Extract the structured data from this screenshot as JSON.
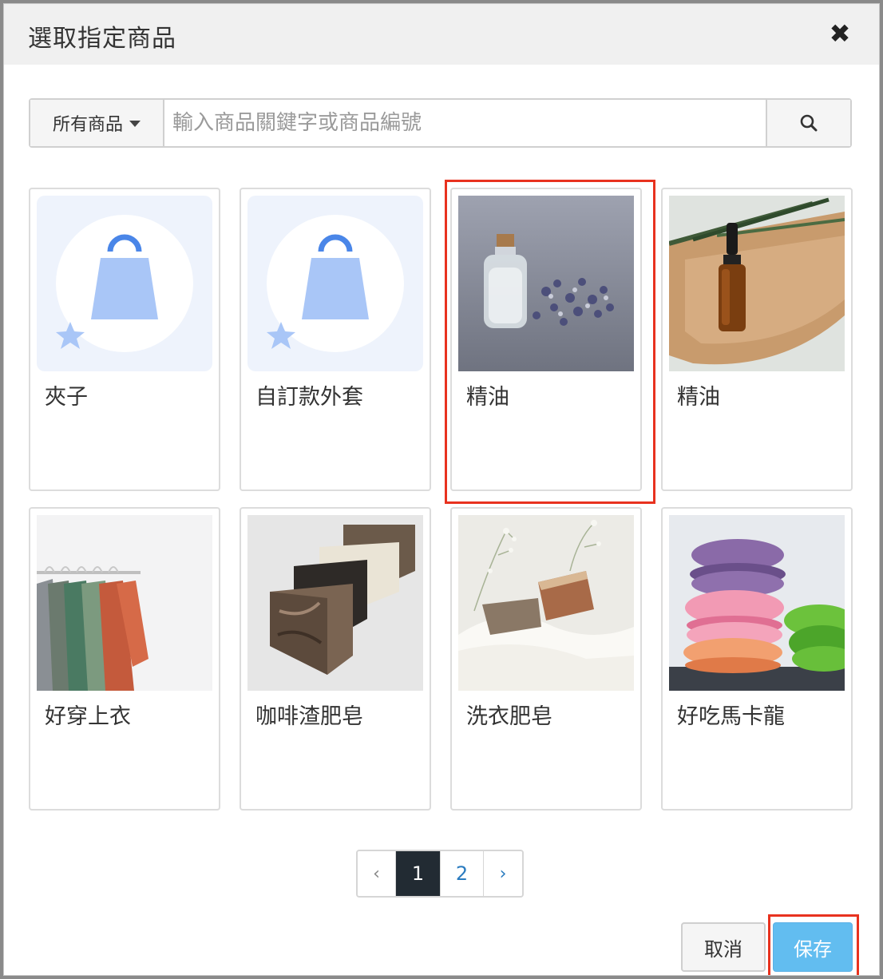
{
  "dialog": {
    "title": "選取指定商品",
    "close_icon": "close-icon"
  },
  "search": {
    "filter_label": "所有商品",
    "placeholder": "輸入商品關鍵字或商品編號",
    "search_icon": "search-icon"
  },
  "products": [
    {
      "name": "夾子",
      "image": "placeholder-bag-icon"
    },
    {
      "name": "自訂款外套",
      "image": "placeholder-bag-icon"
    },
    {
      "name": "精油",
      "image": "essential-oil-lavender-photo",
      "highlighted": true
    },
    {
      "name": "精油",
      "image": "essential-oil-dropper-photo"
    },
    {
      "name": "好穿上衣",
      "image": "clothes-rack-photo"
    },
    {
      "name": "咖啡渣肥皂",
      "image": "soap-bars-photo"
    },
    {
      "name": "洗衣肥皂",
      "image": "laundry-soap-photo"
    },
    {
      "name": "好吃馬卡龍",
      "image": "macarons-photo"
    }
  ],
  "pagination": {
    "prev": "‹",
    "pages": [
      "1",
      "2"
    ],
    "current": "1",
    "next": "›"
  },
  "footer": {
    "cancel_label": "取消",
    "save_label": "保存"
  },
  "colors": {
    "highlight": "#e8321f",
    "save_button": "#62bdf0",
    "active_page": "#222b33",
    "link": "#2a7bbf"
  }
}
